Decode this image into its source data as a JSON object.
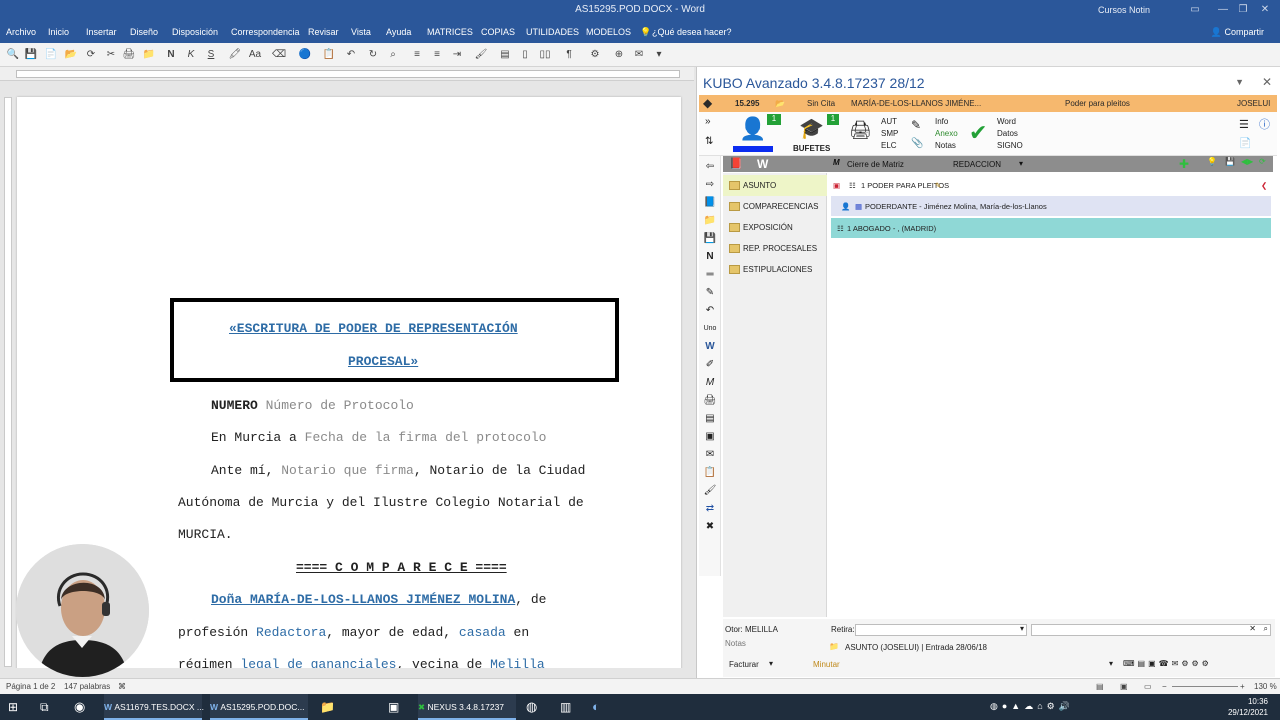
{
  "window": {
    "title": "AS15295.POD.DOCX  -  Word",
    "user": "Cursos Notin"
  },
  "ribbon": {
    "tabs": [
      "Archivo",
      "Inicio",
      "Insertar",
      "Diseño",
      "Disposición",
      "Correspondencia",
      "Revisar",
      "Vista",
      "Ayuda",
      "MATRICES",
      "COPIAS",
      "UTILIDADES",
      "MODELOS",
      "¿Qué desea hacer?"
    ],
    "share": "Compartir"
  },
  "document": {
    "box_title_line1": "«ESCRITURA DE PODER DE REPRESENTACIÓN",
    "box_title_line2": "PROCESAL»",
    "numero_label": "NUMERO",
    "numero_value": "Número de Protocolo",
    "place_prefix": "En Murcia a",
    "place_value": "Fecha de la firma del protocolo",
    "ante_prefix": "Ante mí,",
    "ante_value": "Notario que firma",
    "ante_suffix": ", Notario de la Ciudad",
    "line4": "Autónoma de Murcia y del Ilustre Colegio Notarial de",
    "line5": "MURCIA.",
    "comparece": "==== C O M P A R E C E ====",
    "person_name": "Doña  MARÍA-DE-LOS-LLANOS  JIMÉNEZ  MOLINA",
    "person_after": ",  de",
    "prof_prefix": "profesión",
    "prof_value": "Redactora",
    "prof_mid": ",  mayor de edad,",
    "estado": "casada",
    "prof_suffix": "en",
    "regimen_prefix": "régimen",
    "regimen_value": "legal de gananciales",
    "regimen_mid": ",  vecina de",
    "ciudad": "Melilla"
  },
  "status": {
    "page": "Página 1 de 2",
    "words": "147 palabras",
    "zoom": "130 %"
  },
  "kubo": {
    "title": "KUBO Avanzado 3.4.8.17237   28/12",
    "case": {
      "number": "15.295",
      "cita": "Sin Cita",
      "client": "MARÍA-DE-LOS-LLANOS JIMÉNE...",
      "type": "Poder para pleitos",
      "user": "JOSELUI"
    },
    "tools": {
      "badge1": "1",
      "badge2": "1",
      "bufetes": "BUFETES",
      "aut": "AUT",
      "smp": "SMP",
      "elc": "ELC",
      "info": "Info",
      "anexo": "Anexo",
      "notas": "Notas",
      "word": "Word",
      "datos": "Datos",
      "signo": "SIGNO"
    },
    "subbar": {
      "cierre": "Cierre de Matriz",
      "redaccion": "REDACCION"
    },
    "nav": [
      "ASUNTO",
      "COMPARECENCIAS",
      "EXPOSICIÓN",
      "REP. PROCESALES",
      "ESTIPULACIONES"
    ],
    "rows": {
      "r1": "1 PODER PARA PLEITOS",
      "r2": "PODERDANTE - Jiménez Molina, María-de-los-Llanos",
      "r3": "1 ABOGADO -  ,  (MADRID)"
    },
    "bottom": {
      "otor": "Otor: MELILLA",
      "retira": "Retira:",
      "notas": "Notas",
      "asunto": "ASUNTO (JOSELUI)   |  Entrada 28/06/18",
      "facturar": "Facturar",
      "minutar": "Minutar"
    }
  },
  "taskbar": {
    "apps": [
      "AS11679.TES.DOCX ...",
      "AS15295.POD.DOC...",
      "NEXUS   3.4.8.17237"
    ],
    "time": "10:36",
    "date": "29/12/2021"
  },
  "colors": {
    "word_blue": "#2b579a",
    "kubo_orange": "#f6b86e",
    "row_teal": "#8fd8d6",
    "link_blue": "#2e6ca6"
  }
}
